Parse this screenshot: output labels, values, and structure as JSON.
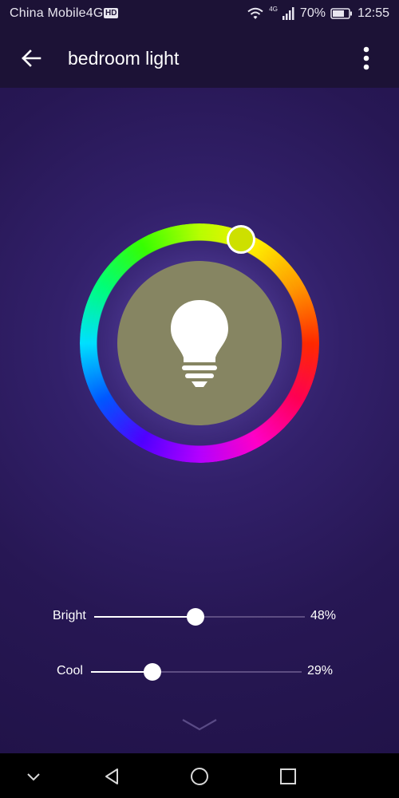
{
  "status_bar": {
    "carrier": "China Mobile4G",
    "hd_badge": "HD",
    "network": "4G",
    "battery": "70%",
    "time": "12:55"
  },
  "app_bar": {
    "title": "bedroom light"
  },
  "color_wheel": {
    "selected_color": "#cde000",
    "bulb_background": "#868562"
  },
  "sliders": {
    "bright": {
      "label": "Bright",
      "value_text": "48%",
      "value": 48
    },
    "cool": {
      "label": "Cool",
      "value_text": "29%",
      "value": 29
    }
  },
  "icons": {
    "back": "arrow-left-icon",
    "more": "more-vertical-icon",
    "bulb": "lightbulb-icon",
    "expand": "chevron-down-icon",
    "nav_collapse": "chevron-down-icon",
    "nav_back": "triangle-back-icon",
    "nav_home": "circle-home-icon",
    "nav_recents": "square-recents-icon"
  },
  "colors": {
    "background": "#2a1850",
    "app_bar": "#1c1236",
    "track": "#5d4d82"
  }
}
